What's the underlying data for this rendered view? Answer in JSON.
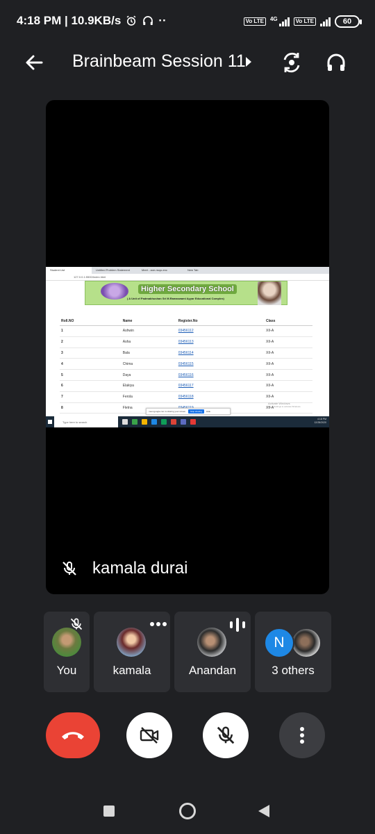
{
  "status_bar": {
    "time_speed": "4:18 PM | 10.9KB/s",
    "dots": "··",
    "net_label": "4G",
    "volte": "Vo LTE",
    "battery": "60"
  },
  "header": {
    "meeting_title": "Brainbeam Session 11"
  },
  "main_tile": {
    "presenter": "kamala durai",
    "shared_screen": {
      "tabs": [
        "Student List",
        "Untitled Problem Statement",
        "Meet - aoe-nsqo-enc",
        "New Tab"
      ],
      "url": "127.0.0.1:5500/Index.html",
      "banner_title": "Higher Secondary School",
      "banner_subtitle": "( A Unit of Padmabhushan Sri M.Ramaswami Ayyar Educational Complex)",
      "table": {
        "headers": [
          "Roll.NO",
          "Name",
          "Register.No",
          "Class"
        ],
        "rows": [
          [
            "1",
            "Ashwin",
            "03456112",
            "XII-A"
          ],
          [
            "2",
            "Asha",
            "03456113",
            "XII-A"
          ],
          [
            "3",
            "Bala",
            "03456114",
            "XII-A"
          ],
          [
            "4",
            "Chima",
            "03456115",
            "XII-A"
          ],
          [
            "5",
            "Daya",
            "03456116",
            "XII-A"
          ],
          [
            "6",
            "Elakiya",
            "03456117",
            "XII-A"
          ],
          [
            "7",
            "Ferola",
            "03456118",
            "XII-A"
          ],
          [
            "8",
            "Fletna",
            "03456119",
            "XII-A"
          ]
        ]
      },
      "share_bar_text": "meet.google.com is sharing your screen.",
      "stop_sharing": "Stop sharing",
      "hide": "Hide",
      "activate_windows": "Activate Windows",
      "activate_sub": "Go to Settings to activate Windows.",
      "taskbar_search": "Type here to search",
      "taskbar_time": "4:18 PM",
      "taskbar_date": "12/28/2020"
    }
  },
  "participants": [
    {
      "name": "You"
    },
    {
      "name": "kamala"
    },
    {
      "name": "Anandan"
    },
    {
      "name": "3 others",
      "initial": "N"
    }
  ]
}
